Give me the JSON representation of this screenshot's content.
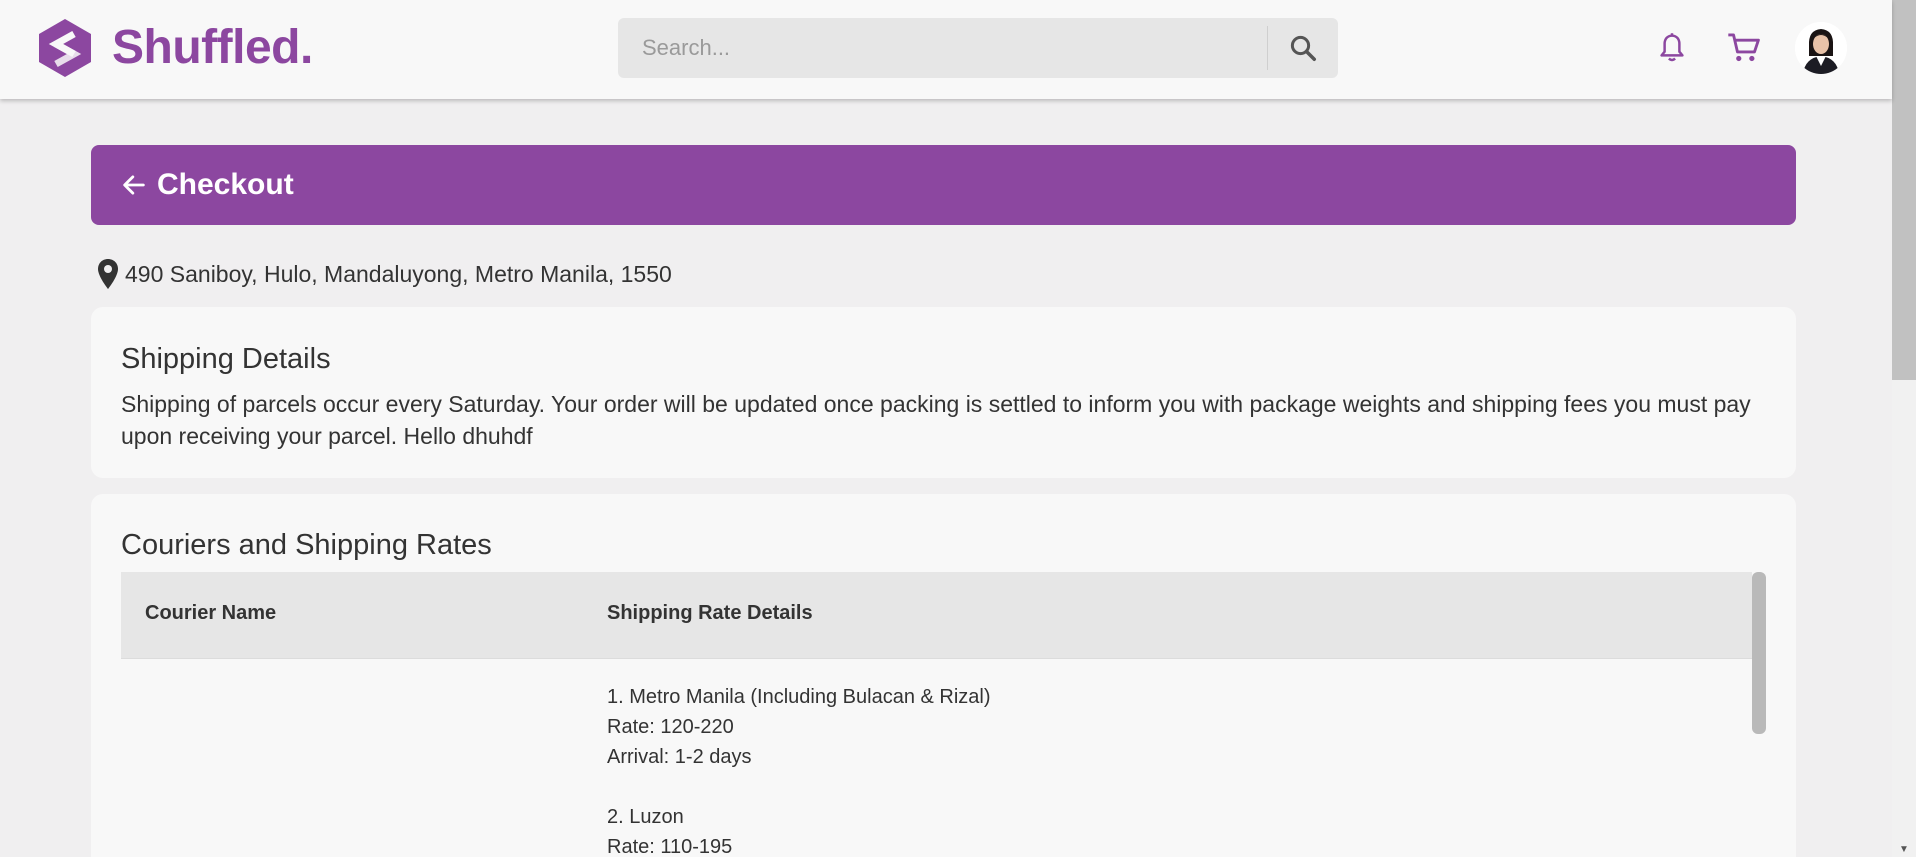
{
  "header": {
    "logo_text": "Shuffled.",
    "search": {
      "placeholder": "Search...",
      "value": ""
    }
  },
  "checkout": {
    "title": "Checkout"
  },
  "address": {
    "text": "490 Saniboy, Hulo, Mandaluyong, Metro Manila, 1550"
  },
  "shipping_details": {
    "title": "Shipping Details",
    "text": "Shipping of parcels occur every Saturday. Your order will be updated once packing is settled to inform you with package weights and shipping fees you must pay upon receiving your parcel. Hello dhuhdf"
  },
  "couriers": {
    "title": "Couriers and Shipping Rates",
    "columns": [
      "Courier Name",
      "Shipping Rate Details"
    ],
    "rows": [
      {
        "courier_name": "",
        "rates": [
          {
            "region": "1. Metro Manila (Including Bulacan & Rizal)",
            "rate": "Rate: 120-220",
            "arrival": "Arrival: 1-2 days"
          },
          {
            "region": "2. Luzon",
            "rate": "Rate: 110-195",
            "arrival": ""
          }
        ]
      }
    ]
  },
  "colors": {
    "brand_purple": "#8c47a0",
    "page_background": "#f0eff0",
    "card_background": "#f8f8f8",
    "table_header_background": "#e6e6e6"
  },
  "icons": [
    "logo-mark-icon",
    "search-icon",
    "bell-icon",
    "cart-icon",
    "back-arrow-icon",
    "location-pin-icon"
  ]
}
